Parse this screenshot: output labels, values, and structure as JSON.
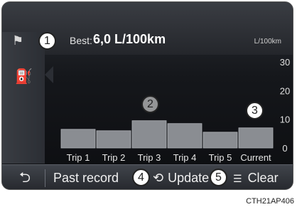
{
  "top": {
    "best_label": "Best:",
    "best_value": "6,0 L/100km",
    "unit_label": "L/100km"
  },
  "icons": {
    "flag": "checkered-flag-icon",
    "fuel": "fuel-pump-icon",
    "back": "back-arrow-icon",
    "update": "refresh-icon",
    "clear": "clear-icon"
  },
  "chart_data": {
    "type": "bar",
    "categories": [
      "Trip 1",
      "Trip 2",
      "Trip 3",
      "Trip 4",
      "Trip 5",
      "Current"
    ],
    "values": [
      6.5,
      6.0,
      9.5,
      8.5,
      5.5,
      7.0
    ],
    "ylim": [
      0,
      30
    ],
    "yticks": [
      "0",
      "10",
      "20",
      "30"
    ],
    "grid": false
  },
  "bottom": {
    "back_label": "⮌",
    "past_label": "Past record",
    "update_label": "Update",
    "clear_label": "Clear"
  },
  "callouts": [
    "1",
    "2",
    "3",
    "4",
    "5"
  ],
  "caption": "CTH21AP406"
}
